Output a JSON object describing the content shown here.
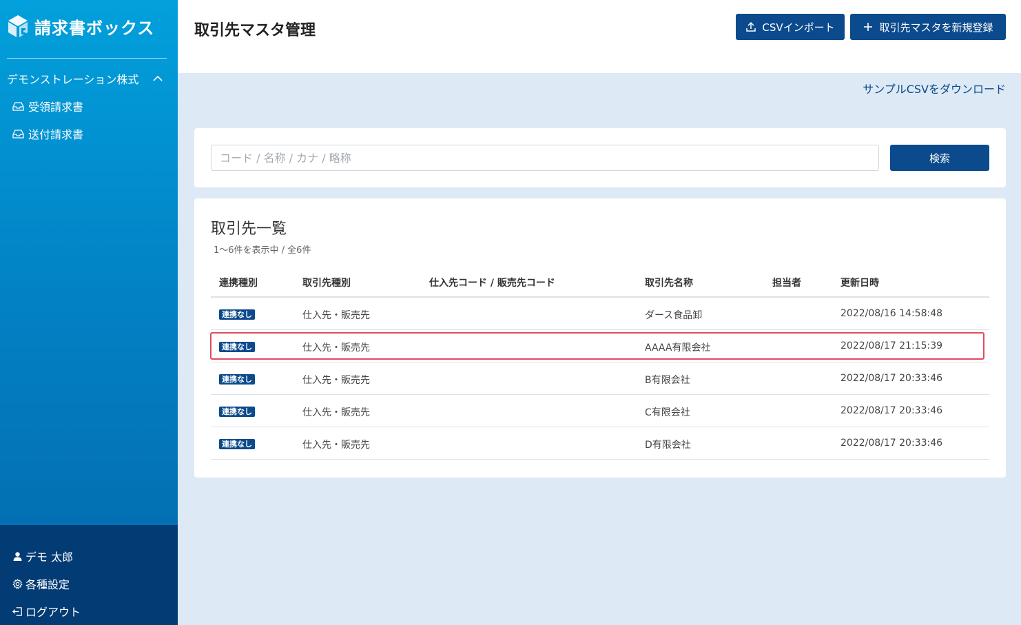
{
  "app": {
    "name": "請求書ボックス"
  },
  "sidebar": {
    "org_name": "デモンストレーション株式",
    "items": [
      {
        "label": "受領請求書",
        "icon": "inbox-icon"
      },
      {
        "label": "送付請求書",
        "icon": "inbox-icon"
      }
    ],
    "bottom": [
      {
        "label": "デモ 太郎",
        "icon": "user-icon"
      },
      {
        "label": "各種設定",
        "icon": "gear-icon"
      },
      {
        "label": "ログアウト",
        "icon": "logout-icon"
      }
    ]
  },
  "header": {
    "title": "取引先マスタ管理",
    "import_label": "CSVインポート",
    "new_label": "取引先マスタを新規登録"
  },
  "download_link": "サンプルCSVをダウンロード",
  "search": {
    "placeholder": "コード / 名称 / カナ / 略称",
    "value": "",
    "button": "検索"
  },
  "list": {
    "title": "取引先一覧",
    "count": "1〜6件を表示中 / 全6件",
    "columns": [
      "連携種別",
      "取引先種別",
      "仕入先コード / 販売先コード",
      "取引先名称",
      "担当者",
      "更新日時"
    ],
    "rows": [
      {
        "link": "連携なし",
        "type": "仕入先・販売先",
        "code": "",
        "name": "ダース食品卸",
        "person": "",
        "updated": "2022/08/16 14:58:48"
      },
      {
        "link": "連携なし",
        "type": "仕入先・販売先",
        "code": "",
        "name": "AAAA有限会社",
        "person": "",
        "updated": "2022/08/17 21:15:39"
      },
      {
        "link": "連携なし",
        "type": "仕入先・販売先",
        "code": "",
        "name": "B有限会社",
        "person": "",
        "updated": "2022/08/17 20:33:46"
      },
      {
        "link": "連携なし",
        "type": "仕入先・販売先",
        "code": "",
        "name": "C有限会社",
        "person": "",
        "updated": "2022/08/17 20:33:46"
      },
      {
        "link": "連携なし",
        "type": "仕入先・販売先",
        "code": "",
        "name": "D有限会社",
        "person": "",
        "updated": "2022/08/17 20:33:46"
      }
    ]
  },
  "colors": {
    "primary": "#0b4a8c",
    "sidebar_top": "#02a0dc",
    "sidebar_bottom": "#033b74",
    "highlight": "#e04a5e"
  }
}
